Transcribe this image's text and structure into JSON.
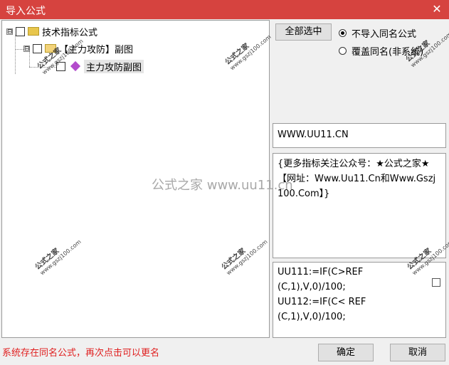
{
  "window": {
    "title": "导入公式",
    "close_glyph": "✕"
  },
  "tree": {
    "root": {
      "expander": "⊟",
      "label": "技术指标公式"
    },
    "child": {
      "expander": "⊟",
      "label": "【主力攻防】副图"
    },
    "leaf": {
      "label": "主力攻防副图"
    }
  },
  "buttons": {
    "select_all": "全部选中",
    "ok": "确定",
    "cancel": "取消"
  },
  "options": {
    "skip_same_name": {
      "label": "不导入同名公式",
      "checked": true
    },
    "overwrite_same_name": {
      "label": "覆盖同名(非系统)",
      "checked": false
    }
  },
  "panels": {
    "name_field": "WWW.UU11.CN",
    "description": "{更多指标关注公众号：★公式之家★【网址：Www.Uu11.Cn和Www.Gszj100.Com】}",
    "formula": "UU111:=IF(C>REF\n(C,1),V,0)/100;\nUU112:=IF(C< REF\n(C,1),V,0)/100;"
  },
  "status_message": "系统存在同名公式，再次点击可以更名",
  "watermarks": {
    "brand": "公式之家",
    "url": "www.gszj100.com",
    "center": "公式之家 www.uu11.cn"
  }
}
